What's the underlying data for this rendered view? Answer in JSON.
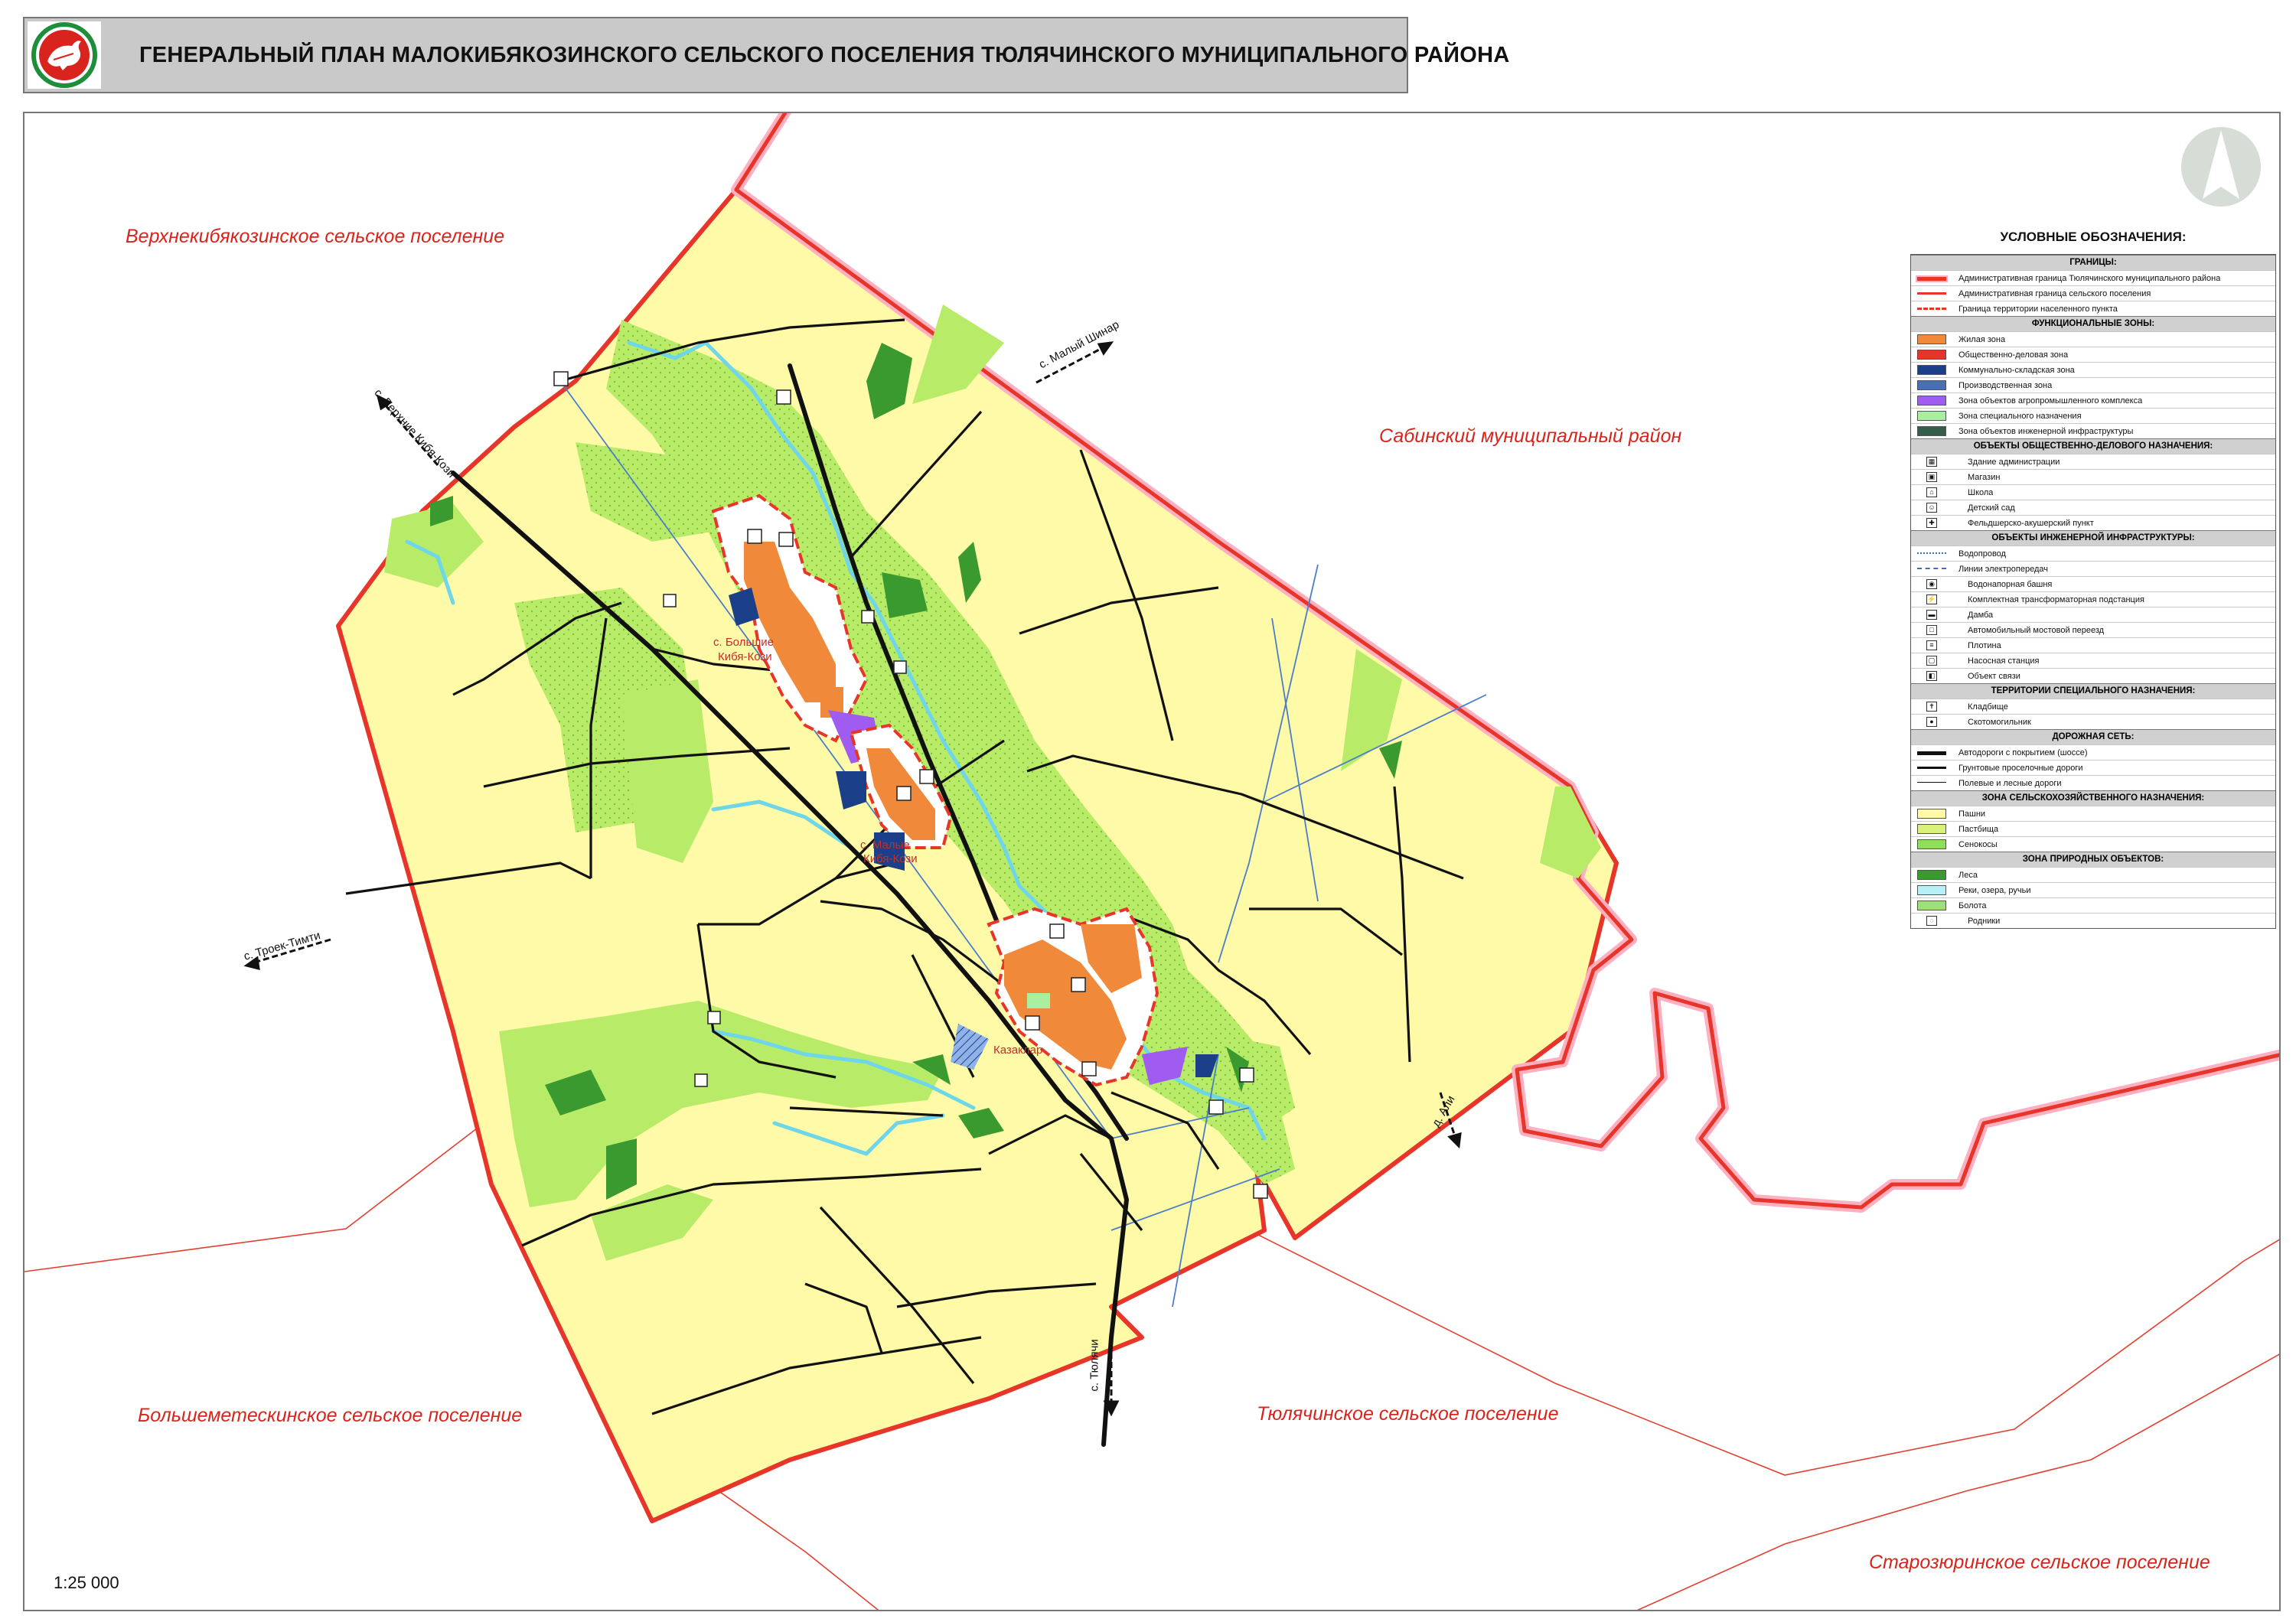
{
  "header": {
    "title": "ГЕНЕРАЛЬНЫЙ ПЛАН МАЛОКИБЯКОЗИНСКОГО СЕЛЬСКОГО ПОСЕЛЕНИЯ ТЮЛЯЧИНСКОГО МУНИЦИПАЛЬНОГО РАЙОНА"
  },
  "map": {
    "neighbors": {
      "nw": "Верхнекибякозинское сельское поселение",
      "e": "Сабинский муниципальный район",
      "sw": "Большеметескинское сельское поселение",
      "s": "Тюлячинское сельское поселение",
      "se": "Старозюринское сельское поселение"
    },
    "directions": {
      "malyi_shinar": "с. Малый Шинар",
      "verhnie_kibya_kozi": "с. Верхние Кибя-Кози",
      "troek_timti": "с. Троек-Тимти",
      "ali": "д. Али",
      "tyulyachi": "с. Тюлячи"
    },
    "villages": {
      "bolshie_kibya_kozi_a": "с. Большие",
      "bolshie_kibya_kozi_b": "Кибя-Кози",
      "malye_kibya_kozi_a": "с. Малые",
      "malye_kibya_kozi_b": "Кибя-Кози",
      "kazaklar": "Казаклар"
    },
    "scale": "1:25 000"
  },
  "colors": {
    "farmland": "#fffaa8",
    "meadow": "#b8ec68",
    "forest": "#3a9a2f",
    "water": "#6fd6ea",
    "residential": "#f08a3a",
    "warehouse": "#1c3f8a",
    "agro": "#a05bf0",
    "road": "#111111",
    "boundary": "#e8352a"
  },
  "legend": {
    "title": "УСЛОВНЫЕ ОБОЗНАЧЕНИЯ:",
    "sections": [
      {
        "header": "ГРАНИЦЫ:",
        "items": [
          {
            "label": "Административная граница Тюлячинского муниципального района",
            "type": "line",
            "color": "#e8352a",
            "style": "bold"
          },
          {
            "label": "Административная граница сельского поселения",
            "type": "line",
            "color": "#e8352a",
            "style": "thin"
          },
          {
            "label": "Граница территории населенного пункта",
            "type": "line",
            "color": "#e8352a",
            "style": "dash"
          }
        ]
      },
      {
        "header": "ФУНКЦИОНАЛЬНЫЕ ЗОНЫ:",
        "items": [
          {
            "label": "Жилая зона",
            "type": "fill",
            "color": "#f08a3a"
          },
          {
            "label": "Общественно-деловая зона",
            "type": "fill",
            "color": "#e8352a"
          },
          {
            "label": "Коммунально-складская зона",
            "type": "fill",
            "color": "#1c3f8a"
          },
          {
            "label": "Производственная зона",
            "type": "fill",
            "color": "#4a6fb0"
          },
          {
            "label": "Зона объектов агропромышленного комплекса",
            "type": "fill",
            "color": "#a05bf0"
          },
          {
            "label": "Зона специального назначения",
            "type": "fill",
            "color": "#a8f0a0"
          },
          {
            "label": "Зона объектов инженерной инфраструктуры",
            "type": "fill",
            "color": "#355e4a"
          }
        ]
      },
      {
        "header": "ОБЪЕКТЫ ОБЩЕСТВЕННО-ДЕЛОВОГО НАЗНАЧЕНИЯ:",
        "items": [
          {
            "label": "Здание администрации",
            "type": "icon",
            "glyph": "▦"
          },
          {
            "label": "Магазин",
            "type": "icon",
            "glyph": "▣"
          },
          {
            "label": "Школа",
            "type": "icon",
            "glyph": "⌂"
          },
          {
            "label": "Детский сад",
            "type": "icon",
            "glyph": "☺"
          },
          {
            "label": "Фельдшерско-акушерский пункт",
            "type": "icon",
            "glyph": "✚"
          }
        ]
      },
      {
        "header": "ОБЪЕКТЫ ИНЖЕНЕРНОЙ ИНФРАСТРУКТУРЫ:",
        "items": [
          {
            "label": "Водопровод",
            "type": "line",
            "color": "#3b6fc0",
            "style": "dot"
          },
          {
            "label": "Линии электропередач",
            "type": "line",
            "color": "#3b6fc0",
            "style": "dashdot"
          },
          {
            "label": "Водонапорная башня",
            "type": "icon",
            "glyph": "◉"
          },
          {
            "label": "Комплектная трансформаторная подстанция",
            "type": "icon",
            "glyph": "⚡"
          },
          {
            "label": "Дамба",
            "type": "icon",
            "glyph": "▬"
          },
          {
            "label": "Автомобильный мостовой переезд",
            "type": "icon",
            "glyph": "□"
          },
          {
            "label": "Плотина",
            "type": "icon",
            "glyph": "≡"
          },
          {
            "label": "Насосная станция",
            "type": "icon",
            "glyph": "▢"
          },
          {
            "label": "Объект связи",
            "type": "icon",
            "glyph": "◧"
          }
        ]
      },
      {
        "header": "ТЕРРИТОРИИ СПЕЦИАЛЬНОГО НАЗНАЧЕНИЯ:",
        "items": [
          {
            "label": "Кладбище",
            "type": "icon",
            "glyph": "✝"
          },
          {
            "label": "Скотомогильник",
            "type": "icon",
            "glyph": "●"
          }
        ]
      },
      {
        "header": "ДОРОЖНАЯ СЕТЬ:",
        "items": [
          {
            "label": "Автодороги с покрытием (шоссе)",
            "type": "line",
            "color": "#111111",
            "style": "road1"
          },
          {
            "label": "Грунтовые проселочные дороги",
            "type": "line",
            "color": "#111111",
            "style": "road2"
          },
          {
            "label": "Полевые и лесные дороги",
            "type": "line",
            "color": "#111111",
            "style": "road3"
          }
        ]
      },
      {
        "header": "ЗОНА СЕЛЬСКОХОЗЯЙСТВЕННОГО НАЗНАЧЕНИЯ:",
        "items": [
          {
            "label": "Пашни",
            "type": "fill",
            "color": "#fffaa8"
          },
          {
            "label": "Пастбища",
            "type": "fill",
            "color": "#d9f07a"
          },
          {
            "label": "Сенокосы",
            "type": "fill",
            "color": "#8ee05a"
          }
        ]
      },
      {
        "header": "ЗОНА ПРИРОДНЫХ ОБЪЕКТОВ:",
        "items": [
          {
            "label": "Леса",
            "type": "fill",
            "color": "#3a9a2f"
          },
          {
            "label": "Реки, озера, ручьи",
            "type": "fill",
            "color": "#b8f0f8"
          },
          {
            "label": "Болота",
            "type": "fill",
            "color": "#9de079"
          },
          {
            "label": "Родники",
            "type": "icon",
            "glyph": "◌"
          }
        ]
      }
    ]
  }
}
